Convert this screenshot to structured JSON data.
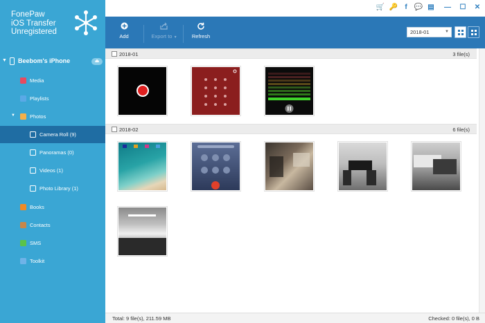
{
  "app": {
    "name_line1": "FonePaw",
    "name_line2": "iOS Transfer",
    "registration": "Unregistered"
  },
  "sidebar": {
    "device": "Beebom's iPhone",
    "items": [
      {
        "label": "Media",
        "icon": "media-icon",
        "color": "#e84a5f"
      },
      {
        "label": "Playlists",
        "icon": "playlist-icon",
        "color": "#5aa9e6"
      },
      {
        "label": "Photos",
        "icon": "photos-icon",
        "color": "#f5b04a"
      },
      {
        "label": "Camera Roll (9)",
        "icon": "camera-icon",
        "color": "#ffffff"
      },
      {
        "label": "Panoramas (0)",
        "icon": "camera-icon",
        "color": "#ffffff"
      },
      {
        "label": "Videos (1)",
        "icon": "camera-icon",
        "color": "#ffffff"
      },
      {
        "label": "Photo Library (1)",
        "icon": "camera-icon",
        "color": "#ffffff"
      },
      {
        "label": "Books",
        "icon": "books-icon",
        "color": "#f08a24"
      },
      {
        "label": "Contacts",
        "icon": "contacts-icon",
        "color": "#c8874a"
      },
      {
        "label": "SMS",
        "icon": "sms-icon",
        "color": "#5ac34a"
      },
      {
        "label": "Toolkit",
        "icon": "toolkit-icon",
        "color": "#6fb3e8"
      }
    ],
    "active_index": 3
  },
  "topbar": {
    "icons": [
      "cart-icon",
      "key-icon",
      "facebook-icon",
      "chat-icon",
      "feedback-icon",
      "minimize-icon",
      "maximize-icon",
      "close-icon"
    ],
    "glyphs": [
      "🛒",
      "🔑",
      "f",
      "💬",
      "▤",
      "—",
      "☐",
      "✕"
    ]
  },
  "toolbar": {
    "add_label": "Add",
    "export_label": "Export to",
    "refresh_label": "Refresh",
    "date_filter": "2018-01"
  },
  "groups": [
    {
      "title": "2018-01",
      "count": "3 file(s)"
    },
    {
      "title": "2018-02",
      "count": "6 file(s)"
    }
  ],
  "status": {
    "total": "Total: 9 file(s), 211.59 MB",
    "checked": "Checked: 0 file(s), 0 B"
  },
  "colors": {
    "sidebar": "#3aa6d4",
    "toolbar": "#2b78b7",
    "active_item": "#1f6da3"
  }
}
